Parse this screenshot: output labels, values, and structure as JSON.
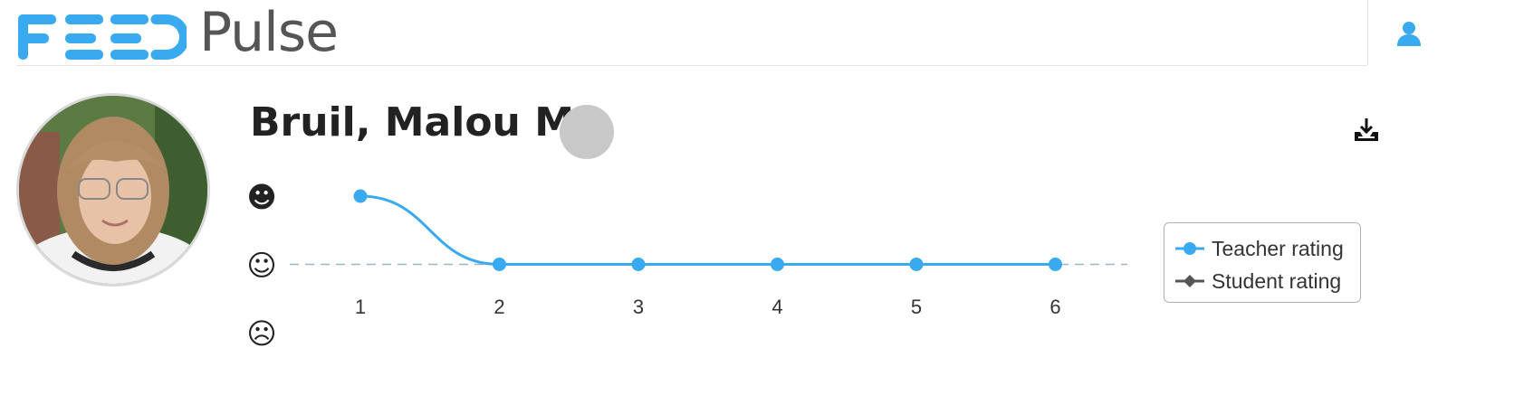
{
  "header": {
    "logo_feed": "FEED",
    "logo_pulse": "Pulse"
  },
  "colors": {
    "brand_blue": "#3aaaf0",
    "neutral_dot": "#c8c8c8",
    "student_series": "#555555"
  },
  "icons": {
    "user": "user-icon",
    "download": "download-icon",
    "avatar": "student-photo"
  },
  "student": {
    "name": "Bruil, Malou M."
  },
  "chart_data": {
    "type": "line",
    "x": [
      1,
      2,
      3,
      4,
      5,
      6
    ],
    "y_levels": [
      "☹",
      "☺",
      "☻"
    ],
    "ylim": [
      0,
      2
    ],
    "reference_line": 1,
    "series": [
      {
        "name": "Teacher rating",
        "values": [
          2,
          1,
          1,
          1,
          1,
          1
        ],
        "color": "#3aaaf0",
        "marker": "circle"
      },
      {
        "name": "Student rating",
        "values": [],
        "color": "#555555",
        "marker": "diamond"
      }
    ],
    "legend_position": "right",
    "grid": false
  }
}
